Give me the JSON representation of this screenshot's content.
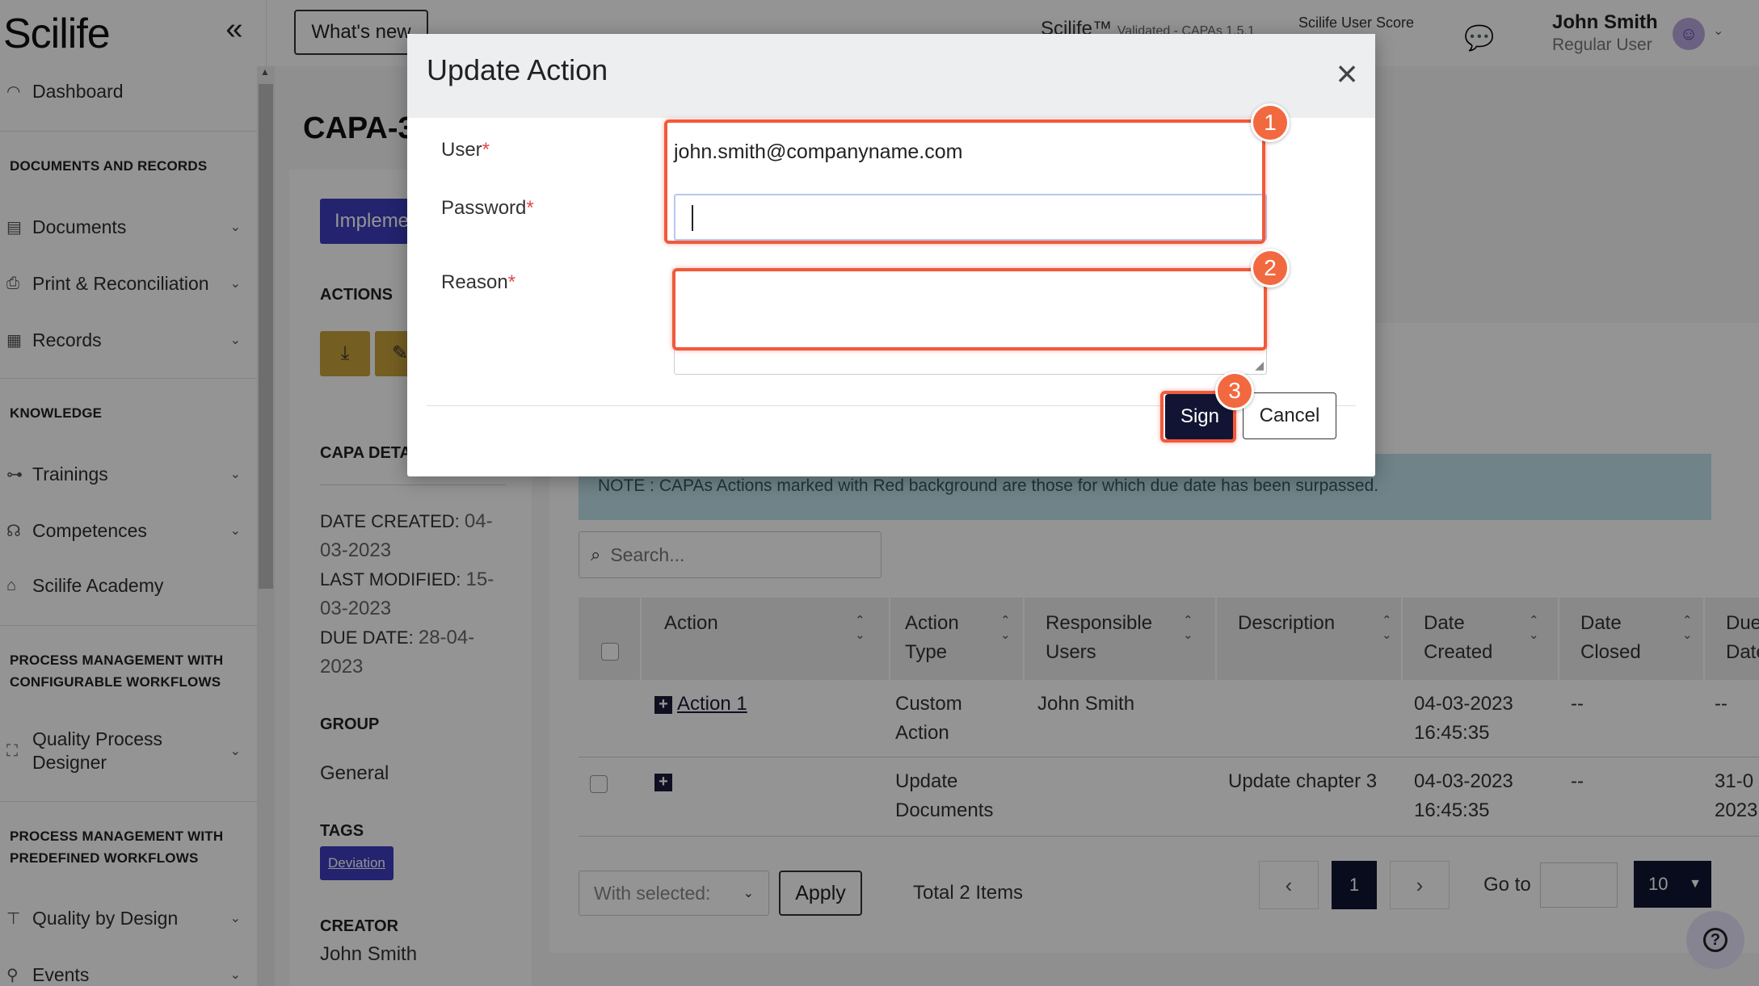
{
  "brand": {
    "logo": "Scilife"
  },
  "sidebar": {
    "collapse_glyph": "«",
    "items": [
      {
        "label": "Dashboard"
      },
      {
        "section": "DOCUMENTS AND RECORDS"
      },
      {
        "label": "Documents"
      },
      {
        "label": "Print & Reconciliation"
      },
      {
        "label": "Records"
      },
      {
        "section": "KNOWLEDGE"
      },
      {
        "label": "Trainings"
      },
      {
        "label": "Competences"
      },
      {
        "label": "Scilife Academy"
      },
      {
        "section": "PROCESS MANAGEMENT WITH CONFIGURABLE WORKFLOWS"
      },
      {
        "label": "Quality Process Designer"
      },
      {
        "section": "PROCESS MANAGEMENT WITH PREDEFINED WORKFLOWS"
      },
      {
        "label": "Quality by Design"
      },
      {
        "label": "Events"
      }
    ]
  },
  "header": {
    "whats_new": "What's new",
    "validated_prefix": "Scilife™",
    "validated_suffix": "Validated - CAPAs 1.5.1",
    "score_label": "Scilife User Score",
    "user_name": "John Smith",
    "user_role": "Regular User"
  },
  "page": {
    "title": "CAPA-3",
    "implement_button": "Impleme",
    "actions_label": "ACTIONS",
    "capa_details_label": "CAPA DETA",
    "date_created_label": "DATE CREATED:",
    "date_created_value": "04-03-2023",
    "last_modified_label": "LAST MODIFIED:",
    "last_modified_value": "15-03-2023",
    "due_date_label": "DUE DATE:",
    "due_date_value": "28-04-2023",
    "group_label": "GROUP",
    "group_value": "General",
    "tags_label": "TAGS",
    "tag": "Deviation",
    "creator_label": "CREATOR",
    "creator_value": "John Smith"
  },
  "content": {
    "note": "NOTE : CAPAs Actions marked with Red background are those for which due date has been surpassed.",
    "search_placeholder": "Search...",
    "columns": [
      {
        "l1": "",
        "l2": "Action"
      },
      {
        "l1": "Action",
        "l2": "Type"
      },
      {
        "l1": "Responsible",
        "l2": "Users"
      },
      {
        "l1": "",
        "l2": "Description"
      },
      {
        "l1": "Date",
        "l2": "Created"
      },
      {
        "l1": "Date",
        "l2": "Closed"
      },
      {
        "l1": "Due",
        "l2": "Date"
      }
    ],
    "rows": [
      {
        "action": "Action 1",
        "type_l1": "Custom",
        "type_l2": "Action",
        "users": "John Smith",
        "description": "",
        "created_l1": "04-03-2023",
        "created_l2": "16:45:35",
        "closed": "--",
        "due_l1": "--",
        "due_l2": ""
      },
      {
        "action": "",
        "type_l1": "Update",
        "type_l2": "Documents",
        "users": "",
        "description": "Update chapter 3",
        "created_l1": "04-03-2023",
        "created_l2": "16:45:35",
        "closed": "--",
        "due_l1": "31-0",
        "due_l2": "2023"
      }
    ],
    "with_selected": "With selected:",
    "apply": "Apply",
    "total_items": "Total 2 Items",
    "current_page": "1",
    "go_to": "Go to",
    "page_size": "10"
  },
  "modal": {
    "title": "Update Action",
    "user_label": "User",
    "user_value": "john.smith@companyname.com",
    "password_label": "Password",
    "password_value": "",
    "reason_label": "Reason",
    "reason_value": "",
    "required_mark": "*",
    "sign": "Sign",
    "cancel": "Cancel"
  },
  "callouts": [
    "1",
    "2",
    "3"
  ],
  "colors": {
    "highlight": "#f05a3c",
    "primary_dark": "#111533",
    "accent_blue": "#3d3dbf"
  }
}
